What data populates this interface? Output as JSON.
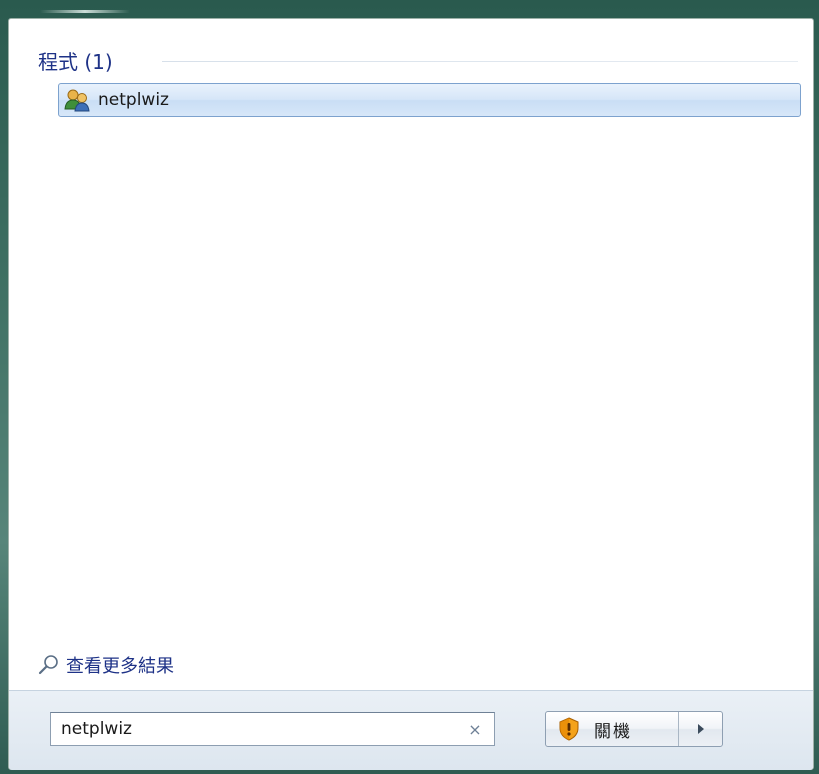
{
  "results": {
    "group_header": "程式 (1)",
    "items": [
      {
        "label": "netplwiz",
        "icon": "users-icon"
      }
    ],
    "see_more": "查看更多結果"
  },
  "search": {
    "value": "netplwiz",
    "clear_glyph": "×"
  },
  "power": {
    "shutdown_label": "關機",
    "shield_icon": "uac-shield-icon",
    "arrow_icon": "right-arrow-icon"
  },
  "colors": {
    "accent_text": "#1e3287",
    "selection_border": "#7da2ce",
    "frame": "#3e6f62"
  }
}
